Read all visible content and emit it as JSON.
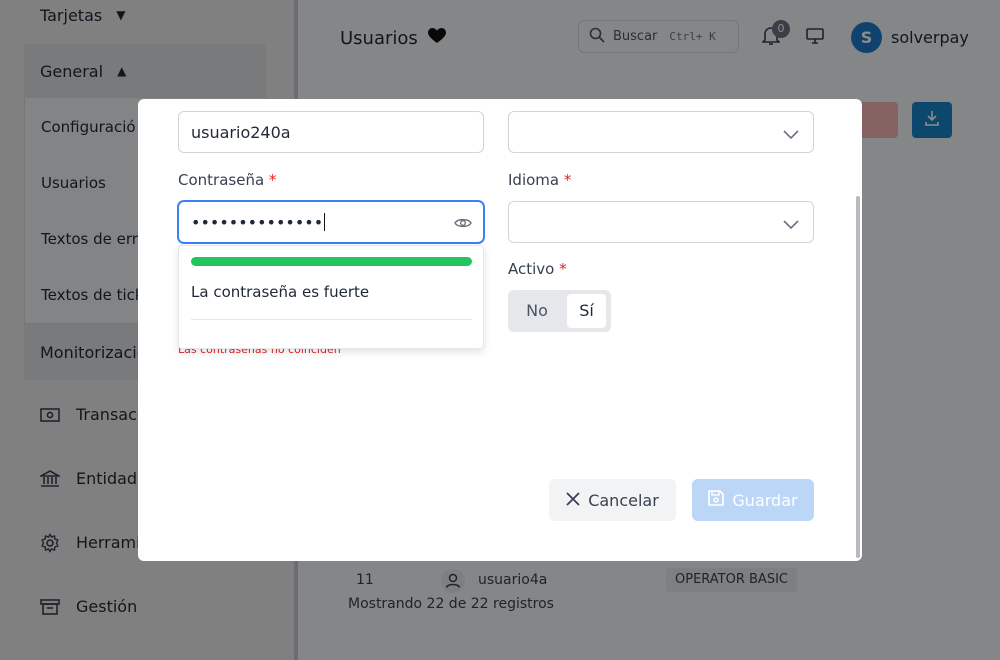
{
  "sidebar": {
    "tarjetas": "Tarjetas",
    "general": "General",
    "sub_items": [
      "Configuració",
      "Usuarios",
      "Textos de err",
      "Textos de tick"
    ],
    "monitorizacion": "Monitorizació",
    "items": [
      {
        "label": "Transacc",
        "icon": "money-icon"
      },
      {
        "label": "Entidade",
        "icon": "bank-icon"
      },
      {
        "label": "Herramie",
        "icon": "gear-icon"
      },
      {
        "label": "Gestión",
        "icon": "archive-icon"
      }
    ]
  },
  "header": {
    "title": "Usuarios",
    "search_label": "Buscar",
    "search_shortcut": "Ctrl+ K",
    "notifications_count": "0",
    "avatar_initial": "S",
    "username": "solverpay"
  },
  "table": {
    "last_row": {
      "num": "11",
      "user": "usuario4a",
      "role": "OPERATOR BASIC"
    },
    "records_text": "Mostrando 22 de 22 registros"
  },
  "modal": {
    "username_value": "usuario240a",
    "password_label": "Contraseña",
    "password_mask": "••••••••••••••",
    "idioma_label": "Idioma",
    "required_mark": "*",
    "strength_text": "La contraseña es fuerte",
    "strength_level": 1.0,
    "mismatch_text": "Las contraseñas no coinciden",
    "activo_label": "Activo",
    "toggle_no": "No",
    "toggle_si": "Sí",
    "cancel_label": "Cancelar",
    "save_label": "Guardar"
  },
  "colors": {
    "accent": "#1684c8",
    "strength_bar": "#22c55e",
    "error": "#dc2626",
    "save_disabled": "#bcd6f8"
  }
}
